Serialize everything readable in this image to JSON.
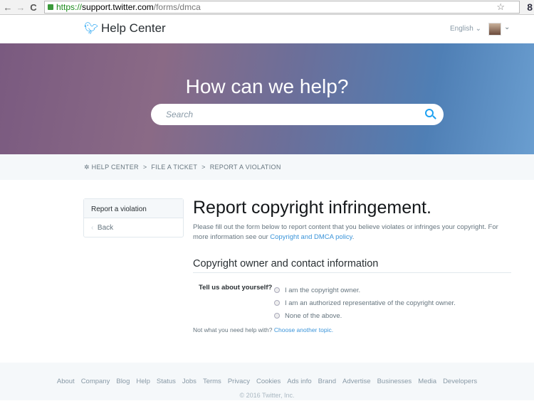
{
  "browser": {
    "back": "←",
    "forward": "→",
    "reload": "C",
    "url_scheme": "https://",
    "url_domain": "support.twitter.com",
    "url_path": "/forms/dmca",
    "star": "☆",
    "extension": "8"
  },
  "header": {
    "logo_text": "Help Center",
    "language": "English",
    "brand_color": "#1da1f2"
  },
  "hero": {
    "title": "How can we help?",
    "search_placeholder": "Search"
  },
  "breadcrumb": [
    "HELP CENTER",
    ">",
    "FILE A TICKET",
    ">",
    "REPORT A VIOLATION"
  ],
  "sidebar": {
    "active": "Report a violation",
    "back": "Back"
  },
  "main": {
    "title": "Report copyright infringement.",
    "desc": "Please fill out the form below to report content that you believe violates or infringes your copyright. For more information see our ",
    "policy_link": "Copyright and DMCA policy",
    "desc_end": ".",
    "section": "Copyright owner and contact information",
    "question": "Tell us about yourself?",
    "options": [
      "I am the copyright owner.",
      "I am an authorized representative of the copyright owner.",
      "None of the above."
    ],
    "other_text": "Not what you need help with? ",
    "other_link": "Choose another topic."
  },
  "footer": {
    "links": [
      "About",
      "Company",
      "Blog",
      "Help",
      "Status",
      "Jobs",
      "Terms",
      "Privacy",
      "Cookies",
      "Ads info",
      "Brand",
      "Advertise",
      "Businesses",
      "Media",
      "Developers"
    ],
    "copyright": "© 2016 Twitter, Inc."
  }
}
